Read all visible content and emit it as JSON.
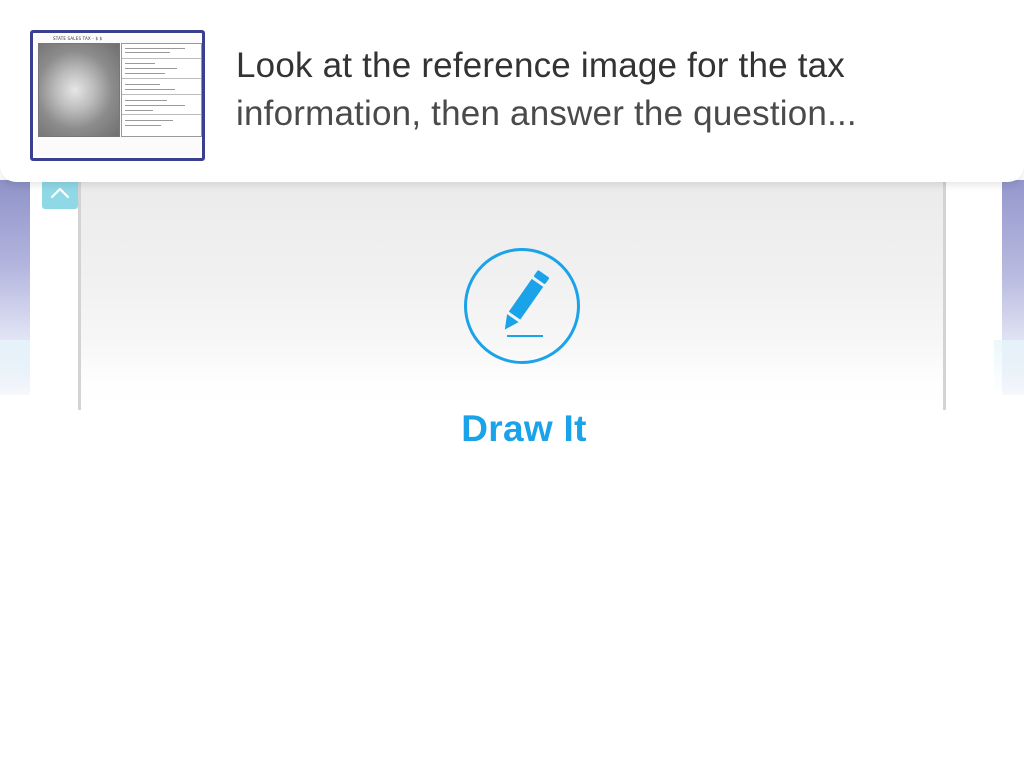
{
  "question": {
    "line1": "Look at the reference image for the tax",
    "line2": "information, then answer the question..."
  },
  "reference_image": {
    "thumb_title": "STATE SALES TAX - $ $",
    "icon": "reference-image-thumbnail"
  },
  "collapse": {
    "icon": "chevron-up-icon"
  },
  "draw_action": {
    "label": "Draw It",
    "icon": "pencil-icon"
  },
  "colors": {
    "accent": "#1aa3e8",
    "text": "#333333",
    "thumb_border": "#3a3f8f",
    "collapse_button": "#8fd8e6"
  }
}
